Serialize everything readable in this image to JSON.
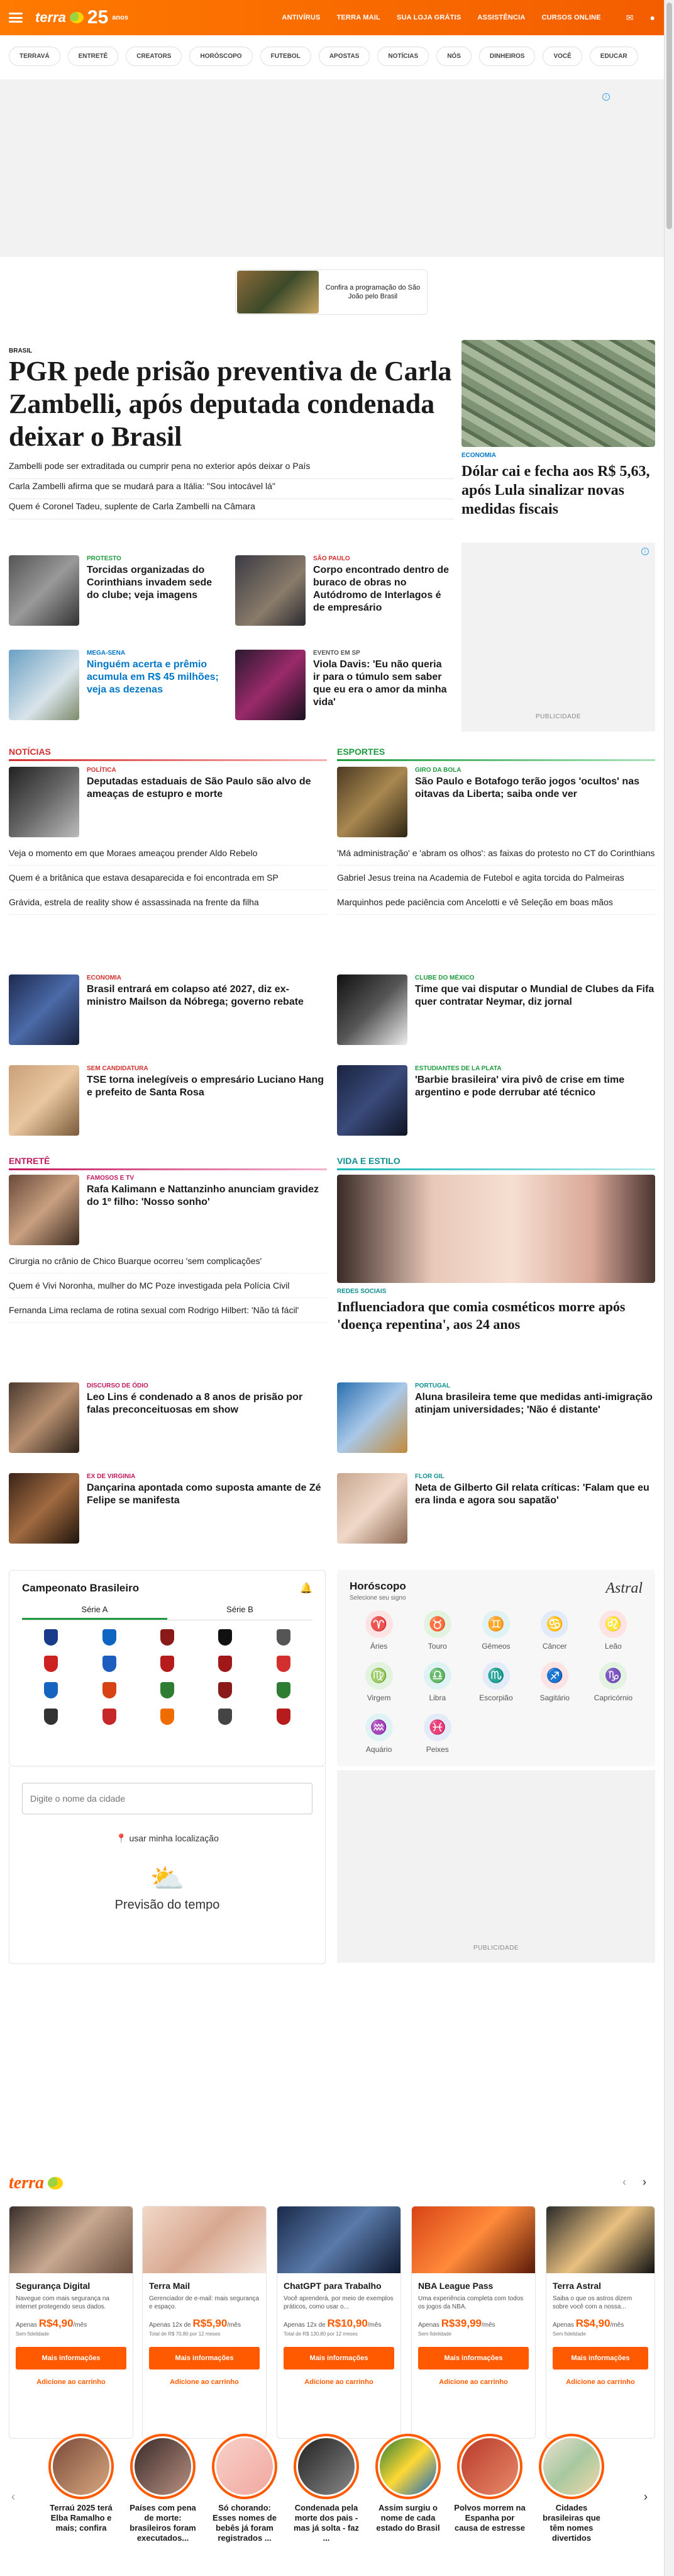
{
  "header": {
    "logo": "terra",
    "anniversary_num": "25",
    "anniversary_label": "anos",
    "links": [
      "ANTIVÍRUS",
      "TERRA MAIL",
      "SUA LOJA GRÁTIS",
      "ASSISTÊNCIA",
      "CURSOS ONLINE"
    ],
    "icon_mail": "mail-icon",
    "icon_user": "user-icon"
  },
  "chips": [
    "TERRAVÁ",
    "ENTRETÊ",
    "CREATORS",
    "HORÓSCOPO",
    "FUTEBOL",
    "APOSTAS",
    "NOTÍCIAS",
    "NÓS",
    "DINHEIROS",
    "VOCÊ",
    "EDUCAR"
  ],
  "promo": {
    "text": "Confira a programação do São João pelo Brasil"
  },
  "hero": {
    "kicker": "BRASIL",
    "title": "PGR pede prisão preventiva de Carla Zambelli, após deputada condenada deixar o Brasil",
    "related": [
      "Zambelli pode ser extraditada ou cumprir pena no exterior após deixar o País",
      "Carla Zambelli afirma que se mudará para a Itália: \"Sou intocável lá\"",
      "Quem é Coronel Tadeu, suplente de Carla Zambelli na Câmara"
    ]
  },
  "side_story": {
    "kicker": "ECONOMIA",
    "title": "Dólar cai e fecha aos R$ 5,63, após Lula sinalizar novas medidas fiscais"
  },
  "grid_cards": [
    {
      "kicker": "PROTESTO",
      "title": "Torcidas organizadas do Corinthians invadem sede do clube; veja imagens"
    },
    {
      "kicker": "SÃO PAULO",
      "title": "Corpo encontrado dentro de buraco de obras no Autódromo de Interlagos é de empresário"
    },
    {
      "kicker": "MEGA-SENA",
      "title": "Ninguém acerta e prêmio acumula em R$ 45 milhões; veja as dezenas"
    },
    {
      "kicker": "EVENTO EM SP",
      "title": "Viola Davis: 'Eu não queria ir para o túmulo sem saber que eu era o amor da minha vida'"
    }
  ],
  "ad_label": "PUBLICIDADE",
  "noticias": {
    "title": "NOTÍCIAS",
    "lead": {
      "kicker": "POLÍTICA",
      "title": "Deputadas estaduais de São Paulo são alvo de ameaças de estupro e morte"
    },
    "links": [
      "Veja o momento em que Moraes ameaçou prender Aldo Rebelo",
      "Quem é a britânica que estava desaparecida e foi encontrada em SP",
      "Grávida, estrela de reality show é assassinada na frente da filha"
    ],
    "cards": [
      {
        "kicker": "ECONOMIA",
        "title": "Brasil entrará em colapso até 2027, diz ex-ministro Mailson da Nóbrega; governo rebate"
      },
      {
        "kicker": "SEM CANDIDATURA",
        "title": "TSE torna inelegíveis o empresário Luciano Hang e prefeito de Santa Rosa"
      }
    ]
  },
  "esportes": {
    "title": "ESPORTES",
    "lead": {
      "kicker": "GIRO DA BOLA",
      "title": "São Paulo e Botafogo terão jogos 'ocultos' nas oitavas da Liberta; saiba onde ver"
    },
    "links": [
      "'Má administração' e 'abram os olhos': as faixas do protesto no CT do Corinthians",
      "Gabriel Jesus treina na Academia de Futebol e agita torcida do Palmeiras",
      "Marquinhos pede paciência com Ancelotti e vê Seleção em boas mãos"
    ],
    "cards": [
      {
        "kicker": "CLUBE DO MÉXICO",
        "title": "Time que vai disputar o Mundial de Clubes da Fifa quer contratar Neymar, diz jornal"
      },
      {
        "kicker": "ESTUDIANTES DE LA PLATA",
        "title": "'Barbie brasileira' vira pivô de crise em time argentino e pode derrubar até técnico"
      }
    ]
  },
  "entrete": {
    "title": "ENTRETÊ",
    "lead": {
      "kicker": "FAMOSOS E TV",
      "title": "Rafa Kalimann e Nattanzinho anunciam gravidez do 1º filho: 'Nosso sonho'"
    },
    "links": [
      "Cirurgia no crânio de Chico Buarque ocorreu 'sem complicações'",
      "Quem é Vivi Noronha, mulher do MC Poze investigada pela Polícia Civil",
      "Fernanda Lima reclama de rotina sexual com Rodrigo Hilbert: 'Não tá fácil'"
    ],
    "cards": [
      {
        "kicker": "DISCURSO DE ÓDIO",
        "title": "Leo Lins é condenado a 8 anos de prisão por falas preconceituosas em show"
      },
      {
        "kicker": "EX DE VIRGINIA",
        "title": "Dançarina apontada como suposta amante de Zé Felipe se manifesta"
      }
    ]
  },
  "vida": {
    "title": "VIDA E ESTILO",
    "lead": {
      "kicker": "REDES SOCIAIS",
      "title": "Influenciadora que comia cosméticos morre após 'doença repentina', aos 24 anos"
    },
    "cards": [
      {
        "kicker": "PORTUGAL",
        "title": "Aluna brasileira teme que medidas anti-imigração atinjam universidades; 'Não é distante'"
      },
      {
        "kicker": "FLOR GIL",
        "title": "Neta de Gilberto Gil relata críticas: 'Falam que eu era linda e agora sou sapatão'"
      }
    ]
  },
  "campeonato": {
    "title": "Campeonato Brasileiro",
    "tab_a": "Série A",
    "tab_b": "Série B"
  },
  "horoscopo": {
    "title": "Horóscopo",
    "subtitle": "Selecione seu signo",
    "brand": "Astral",
    "signs": [
      {
        "name": "Áries",
        "glyph": "♈"
      },
      {
        "name": "Touro",
        "glyph": "♉"
      },
      {
        "name": "Gêmeos",
        "glyph": "♊"
      },
      {
        "name": "Câncer",
        "glyph": "♋"
      },
      {
        "name": "Leão",
        "glyph": "♌"
      },
      {
        "name": "Virgem",
        "glyph": "♍"
      },
      {
        "name": "Libra",
        "glyph": "♎"
      },
      {
        "name": "Escorpião",
        "glyph": "♏"
      },
      {
        "name": "Sagitário",
        "glyph": "♐"
      },
      {
        "name": "Capricórnio",
        "glyph": "♑"
      },
      {
        "name": "Aquário",
        "glyph": "♒"
      },
      {
        "name": "Peixes",
        "glyph": "♓"
      }
    ]
  },
  "weather": {
    "placeholder": "Digite o nome da cidade",
    "location": "usar minha localização",
    "title": "Previsão do tempo"
  },
  "shop": {
    "logo": "terra",
    "items": [
      {
        "name": "Segurança Digital",
        "desc": "Navegue com mais segurança na internet protegendo seus dados.",
        "prefix": "Apenas",
        "price": "R$4,90",
        "unit": "/mês",
        "note": "Sem fidelidade"
      },
      {
        "name": "Terra Mail",
        "desc": "Gerenciador de e-mail: mais segurança e espaço.",
        "prefix": "Apenas 12x de",
        "price": "R$5,90",
        "unit": "/mês",
        "note": "Total de R$ 70,80 por 12 meses"
      },
      {
        "name": "ChatGPT para Trabalho",
        "desc": "Você aprenderá, por meio de exemplos práticos, como usar o...",
        "prefix": "Apenas 12x de",
        "price": "R$10,90",
        "unit": "/mês",
        "note": "Total de R$ 130,80 por 12 meses"
      },
      {
        "name": "NBA League Pass",
        "desc": "Uma experiência completa com todos os jogos da NBA.",
        "prefix": "Apenas",
        "price": "R$39,99",
        "unit": "/mês",
        "note": "Sem fidelidade"
      },
      {
        "name": "Terra Astral",
        "desc": "Saiba o que os astros dizem sobre você com a nossa...",
        "prefix": "Apenas",
        "price": "R$4,90",
        "unit": "/mês",
        "note": "Sem fidelidade"
      }
    ],
    "btn": "Mais informações",
    "cart": "Adicione ao carrinho"
  },
  "stories": [
    "Terraú 2025 terá Elba Ramalho e mais; confira",
    "Países com pena de morte: brasileiros foram executados...",
    "Só chorando: Esses nomes de bebês já foram registrados ...",
    "Condenada pela morte dos pais - mas já solta - faz ...",
    "Assim surgiu o nome de cada estado do Brasil",
    "Polvos morrem na Espanha por causa de estresse",
    "Cidades brasileiras que têm nomes divertidos"
  ]
}
